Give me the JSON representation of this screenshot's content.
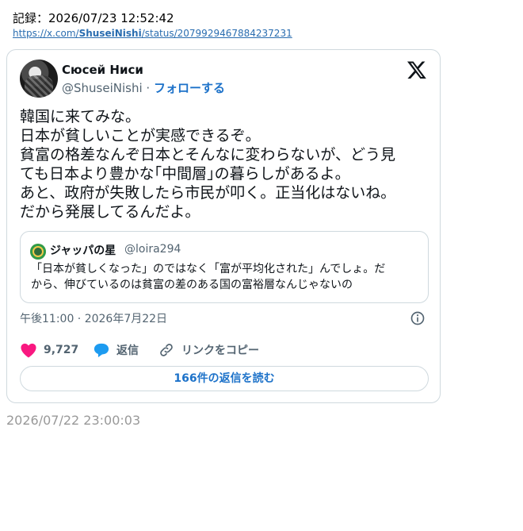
{
  "record_line": "記録：2026/07/23 12:52:42",
  "source_link": {
    "prefix": "https://x.com/",
    "user": "ShuseiNishi",
    "suffix": "/status/2079929467884237231"
  },
  "tweet": {
    "display_name": "Сюсей Ниси",
    "handle": "@ShuseiNishi",
    "separator": "·",
    "follow_label": "フォローする",
    "text_lines": [
      "韓国に来てみな。",
      "日本が貧しいことが実感できるぞ。",
      "貧富の格差なんぞ日本とそんなに変わらないが、どう見",
      "ても日本より豊かな｢中間層｣の暮らしがあるよ。",
      "あと、政府が失敗したら市民が叩く。正当化はないね。",
      "だから発展してるんだよ。"
    ],
    "timestamp": "午後11:00 · 2026年7月22日",
    "like_count": "9,727",
    "reply_label": "返信",
    "copy_link_label": "リンクをコピー",
    "read_replies_label": "166件の返信を読む"
  },
  "quote": {
    "display_name": "ジャッパの星",
    "handle": "@loira294",
    "text_lines": [
      "「日本が貧しくなった」のではなく「富が平均化された」んでしょ。だ",
      "から、伸びているのは貧富の差のある国の富裕層なんじゃないの"
    ]
  },
  "footer_timestamp": "2026/07/22 23:00:03",
  "colors": {
    "accent": "#1d72c9",
    "like": "#f91880",
    "reply": "#1d9bf0",
    "muted": "#536471",
    "border": "#cfd9de"
  },
  "icons": [
    "x-logo-icon",
    "info-icon",
    "heart-icon",
    "reply-bubble-icon",
    "link-icon"
  ]
}
